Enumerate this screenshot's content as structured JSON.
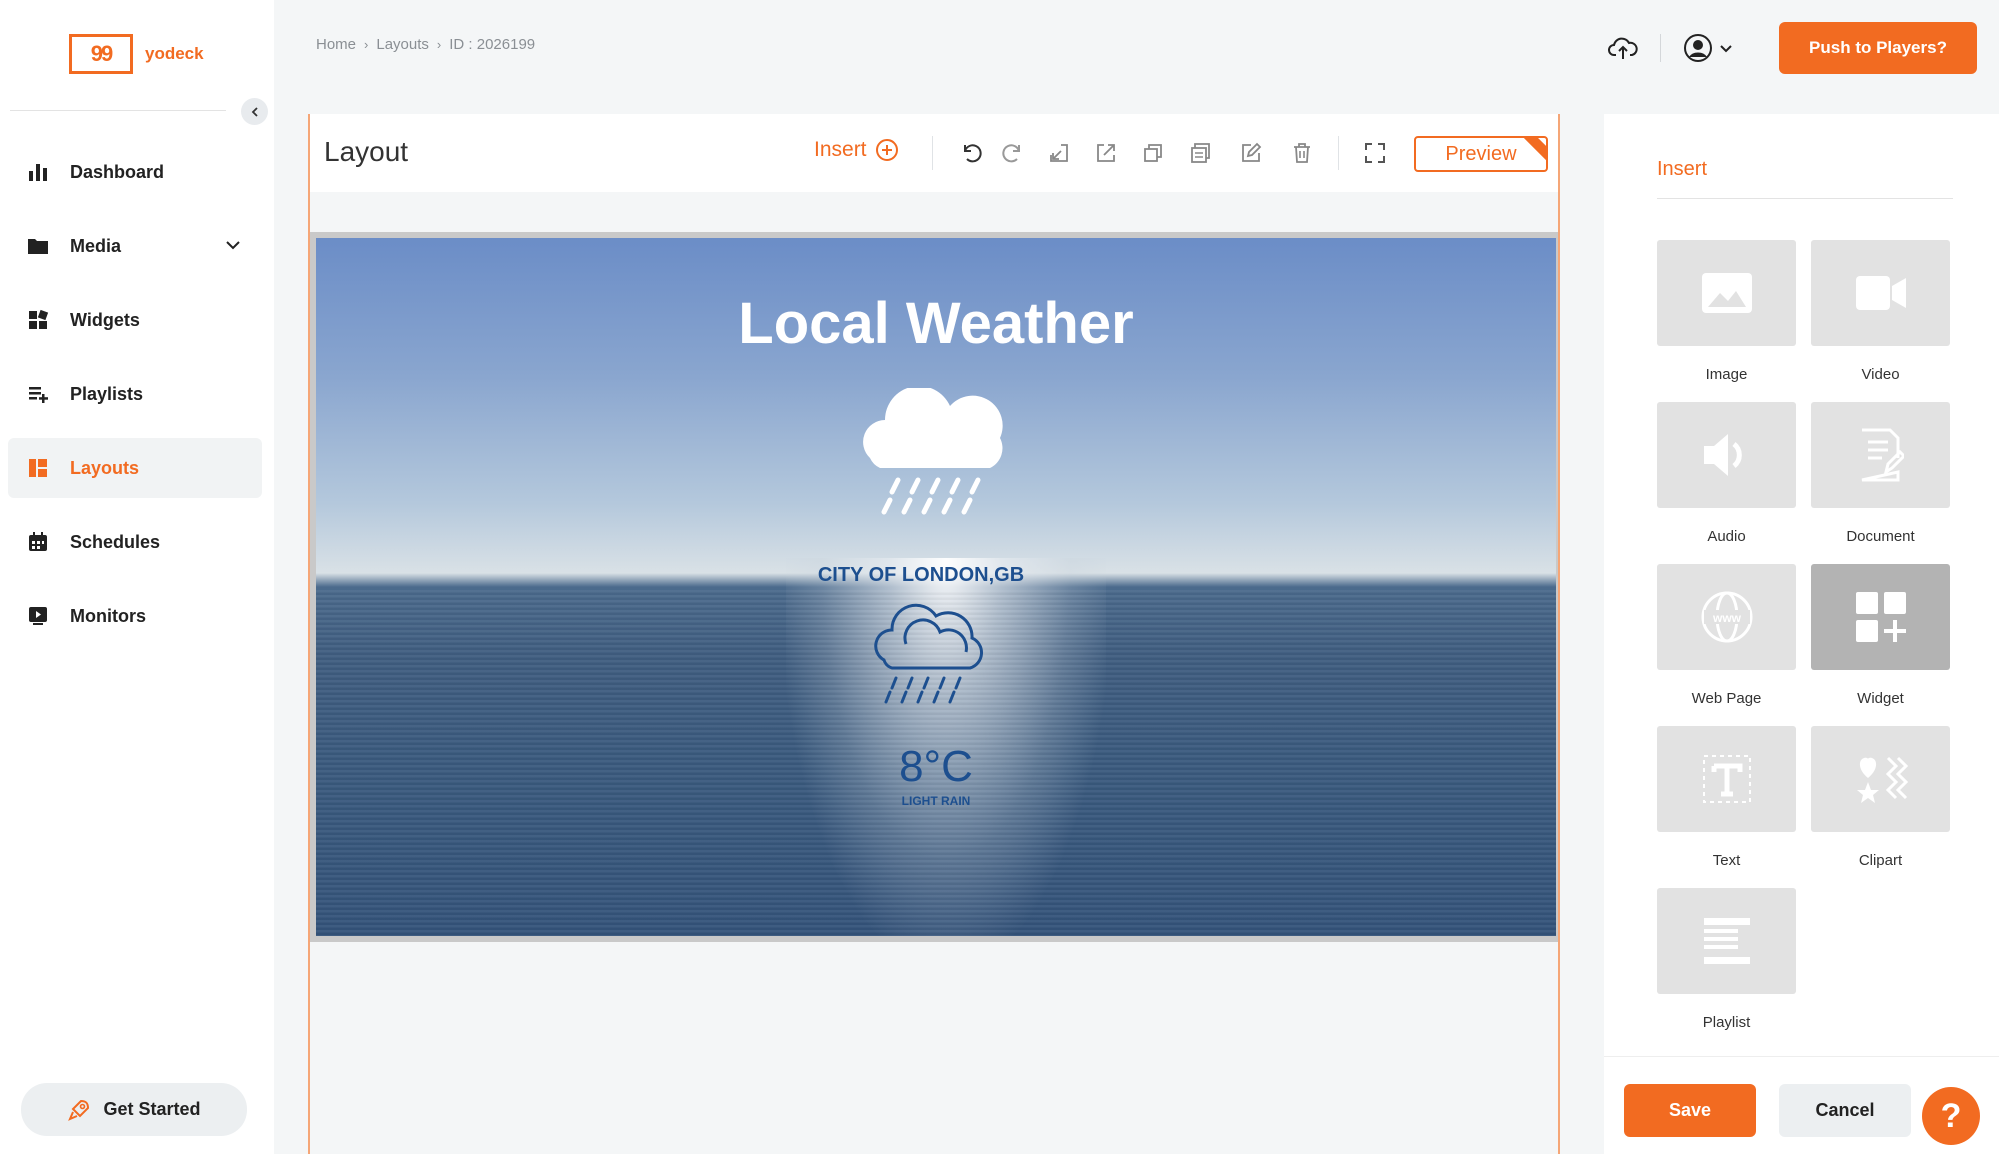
{
  "brand": {
    "name": "yodeck",
    "logo_glyph": "99",
    "accent_color": "#f26b21"
  },
  "sidebar": {
    "items": [
      {
        "label": "Dashboard",
        "icon": "bar-chart-icon"
      },
      {
        "label": "Media",
        "icon": "folder-icon"
      },
      {
        "label": "Widgets",
        "icon": "widgets-icon"
      },
      {
        "label": "Playlists",
        "icon": "playlist-icon"
      },
      {
        "label": "Layouts",
        "icon": "layouts-icon",
        "active": true
      },
      {
        "label": "Schedules",
        "icon": "calendar-icon"
      },
      {
        "label": "Monitors",
        "icon": "monitor-icon"
      }
    ],
    "get_started": "Get Started"
  },
  "breadcrumb": {
    "home": "Home",
    "section": "Layouts",
    "id": "ID : 2026199"
  },
  "header": {
    "push_label": "Push to Players?"
  },
  "editor": {
    "title": "Layout",
    "insert_label": "Insert",
    "preview_label": "Preview",
    "toolbar_icons": [
      "undo-icon",
      "redo-icon",
      "bring-back-icon",
      "bring-front-icon",
      "duplicate-icon",
      "copy-icon",
      "edit-icon",
      "delete-icon",
      "fullscreen-icon"
    ]
  },
  "weather": {
    "title": "Local Weather",
    "city": "CITY OF LONDON,GB",
    "temperature": "8°C",
    "condition": "LIGHT RAIN"
  },
  "insert_panel": {
    "title": "Insert",
    "tiles": [
      {
        "label": "Image",
        "icon": "image-icon"
      },
      {
        "label": "Video",
        "icon": "video-icon"
      },
      {
        "label": "Audio",
        "icon": "audio-icon"
      },
      {
        "label": "Document",
        "icon": "document-icon"
      },
      {
        "label": "Web Page",
        "icon": "globe-icon"
      },
      {
        "label": "Widget",
        "icon": "widget-add-icon"
      },
      {
        "label": "Text",
        "icon": "text-icon"
      },
      {
        "label": "Clipart",
        "icon": "clipart-icon"
      },
      {
        "label": "Playlist",
        "icon": "playlist-lines-icon"
      }
    ]
  },
  "footer": {
    "save_label": "Save",
    "cancel_label": "Cancel",
    "help_label": "?"
  }
}
